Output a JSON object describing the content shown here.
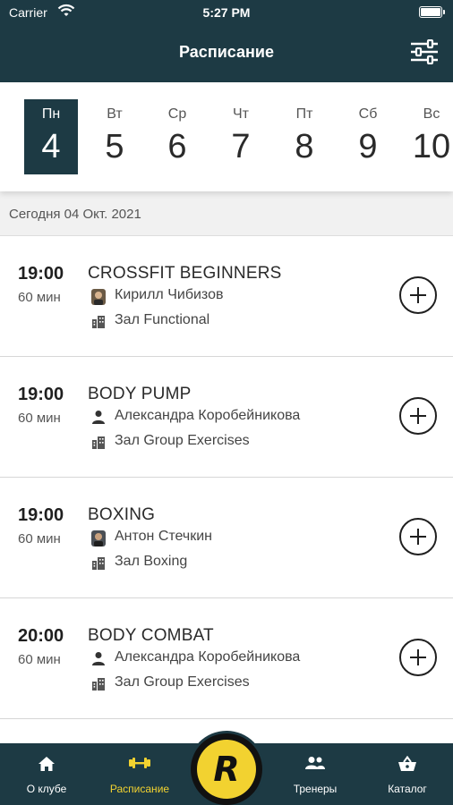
{
  "status_bar": {
    "carrier": "Carrier",
    "time": "5:27 PM"
  },
  "header": {
    "title": "Расписание"
  },
  "days": [
    {
      "name": "Пн",
      "num": "4",
      "active": true
    },
    {
      "name": "Вт",
      "num": "5"
    },
    {
      "name": "Ср",
      "num": "6"
    },
    {
      "name": "Чт",
      "num": "7"
    },
    {
      "name": "Пт",
      "num": "8"
    },
    {
      "name": "Сб",
      "num": "9"
    },
    {
      "name": "Вс",
      "num": "10"
    }
  ],
  "date_strip": {
    "label": "Сегодня 04 Окт. 2021"
  },
  "sessions": [
    {
      "time": "19:00",
      "duration": "60 мин",
      "name": "CROSSFIT BEGINNERS",
      "trainer": "Кирилл Чибизов",
      "hall": "Зал Functional",
      "trainer_icon": "avatar"
    },
    {
      "time": "19:00",
      "duration": "60 мин",
      "name": "BODY PUMP",
      "trainer": "Александра Коробейникова",
      "hall": "Зал Group Exercises",
      "trainer_icon": "person"
    },
    {
      "time": "19:00",
      "duration": "60 мин",
      "name": "BOXING",
      "trainer": "Антон Стечкин",
      "hall": "Зал Boxing",
      "trainer_icon": "avatar"
    },
    {
      "time": "20:00",
      "duration": "60 мин",
      "name": "BODY COMBAT",
      "trainer": "Александра Коробейникова",
      "hall": "Зал Group Exercises",
      "trainer_icon": "person"
    }
  ],
  "tabbar": {
    "about": "О клубе",
    "schedule": "Расписание",
    "logo_letter": "R",
    "trainers": "Тренеры",
    "catalog": "Каталог"
  },
  "colors": {
    "primary": "#1d3a44",
    "accent": "#f2d230"
  }
}
